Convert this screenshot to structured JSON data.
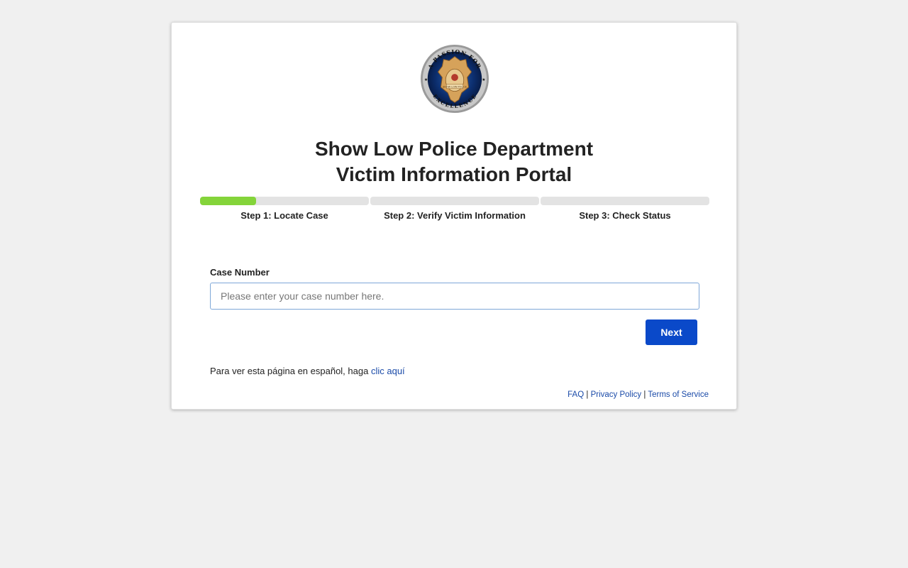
{
  "header": {
    "title_line1": "Show Low Police Department",
    "title_line2": "Victim Information Portal",
    "logo": {
      "top_text": "A PASSION FOR",
      "bottom_text": "EXCELLENCE",
      "badge_text": "SHOW LOW POLICE"
    }
  },
  "steps": [
    {
      "label": "Step 1: Locate Case",
      "progress": 0.33
    },
    {
      "label": "Step 2: Verify Victim Information",
      "progress": 0
    },
    {
      "label": "Step 3: Check Status",
      "progress": 0
    }
  ],
  "form": {
    "case_label": "Case Number",
    "case_placeholder": "Please enter your case number here.",
    "case_value": "",
    "next_label": "Next"
  },
  "spanish": {
    "text": "Para ver esta página en español, haga",
    "link": "clic aquí"
  },
  "footer": {
    "faq": "FAQ",
    "privacy": "Privacy Policy",
    "terms": "Terms of Service",
    "separator": "|"
  },
  "colors": {
    "accent": "#0a49c9",
    "progress_fill": "#84d43a",
    "progress_track": "#e3e3e3",
    "link": "#1a4aa8"
  }
}
